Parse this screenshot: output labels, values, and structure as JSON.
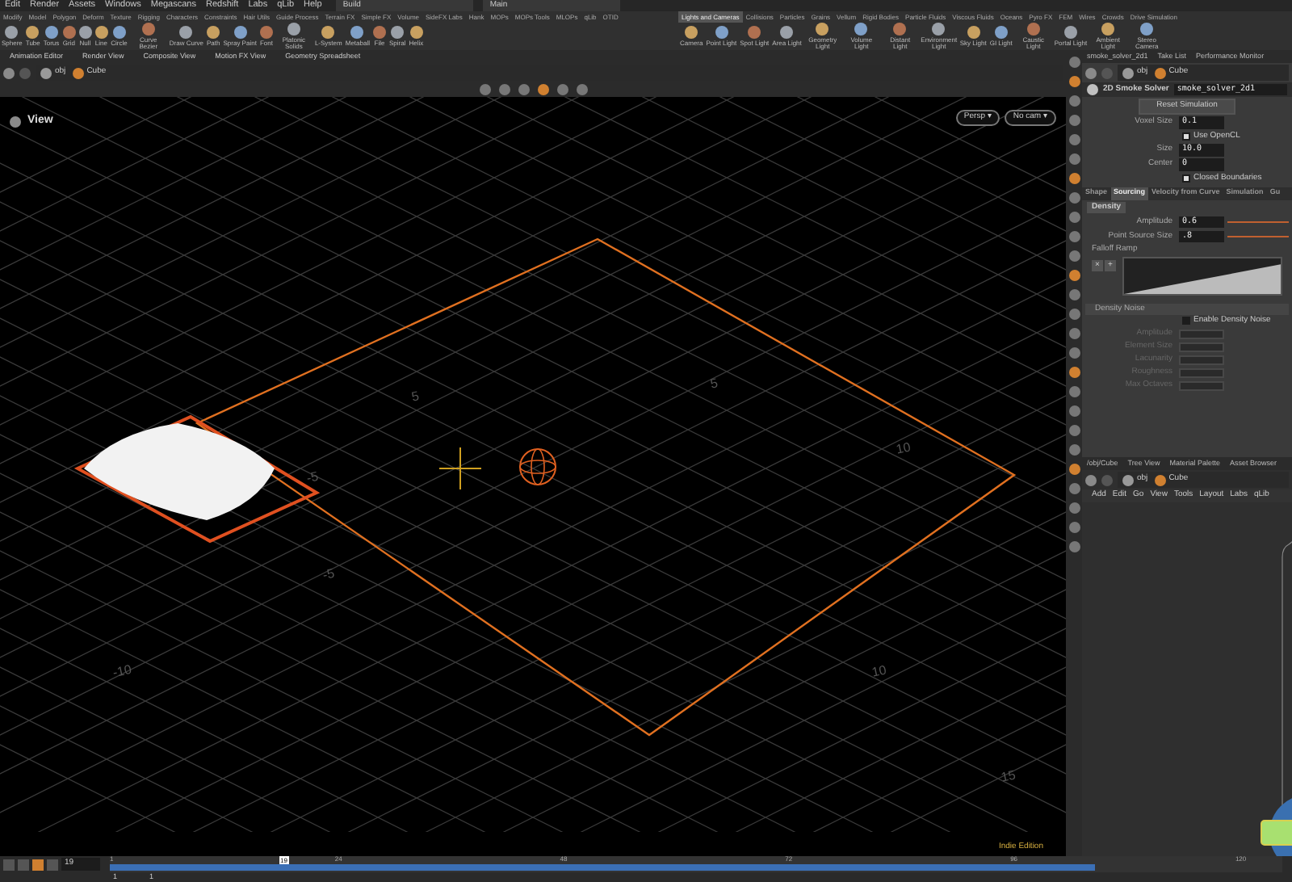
{
  "menu": [
    "Edit",
    "Render",
    "Assets",
    "Windows",
    "Megascans",
    "Redshift",
    "Labs",
    "qLib",
    "Help"
  ],
  "desktops": [
    "Build",
    "Main"
  ],
  "shelf_left": {
    "tabs": [
      {
        "label": "Modify",
        "selected": false
      },
      {
        "label": "Model",
        "selected": false
      },
      {
        "label": "Polygon",
        "selected": false
      },
      {
        "label": "Deform",
        "selected": false
      },
      {
        "label": "Texture",
        "selected": false
      },
      {
        "label": "Rigging",
        "selected": false
      },
      {
        "label": "Characters",
        "selected": false
      },
      {
        "label": "Constraints",
        "selected": false
      },
      {
        "label": "Hair Utils",
        "selected": false
      },
      {
        "label": "Guide Process",
        "selected": false
      },
      {
        "label": "Terrain FX",
        "selected": false
      },
      {
        "label": "Simple FX",
        "selected": false
      },
      {
        "label": "Volume",
        "selected": false
      },
      {
        "label": "SideFX Labs",
        "selected": false
      },
      {
        "label": "Hank",
        "selected": false
      },
      {
        "label": "MOPs",
        "selected": false
      },
      {
        "label": "MOPs Tools",
        "selected": false
      },
      {
        "label": "MLOPs",
        "selected": false
      },
      {
        "label": "qLib",
        "selected": false
      },
      {
        "label": "OTID",
        "selected": false
      }
    ],
    "tools": [
      "Sphere",
      "Tube",
      "Torus",
      "Grid",
      "Null",
      "Line",
      "Circle",
      "Curve Bezier",
      "Draw Curve",
      "Path",
      "Spray Paint",
      "Font",
      "Platonic Solids",
      "L-System",
      "Metaball",
      "File",
      "Spiral",
      "Helix"
    ]
  },
  "shelf_right": {
    "tabs": [
      {
        "label": "Lights and Cameras",
        "selected": true
      },
      {
        "label": "Collisions",
        "selected": false
      },
      {
        "label": "Particles",
        "selected": false
      },
      {
        "label": "Grains",
        "selected": false
      },
      {
        "label": "Vellum",
        "selected": false
      },
      {
        "label": "Rigid Bodies",
        "selected": false
      },
      {
        "label": "Particle Fluids",
        "selected": false
      },
      {
        "label": "Viscous Fluids",
        "selected": false
      },
      {
        "label": "Oceans",
        "selected": false
      },
      {
        "label": "Pyro FX",
        "selected": false
      },
      {
        "label": "FEM",
        "selected": false
      },
      {
        "label": "Wires",
        "selected": false
      },
      {
        "label": "Crowds",
        "selected": false
      },
      {
        "label": "Drive Simulation",
        "selected": false
      }
    ],
    "tools": [
      "Camera",
      "Point Light",
      "Spot Light",
      "Area Light",
      "Geometry Light",
      "Volume Light",
      "Distant Light",
      "Environment Light",
      "Sky Light",
      "GI Light",
      "Caustic Light",
      "Portal Light",
      "Ambient Light",
      "Stereo Camera"
    ]
  },
  "pane_tabs": [
    "Animation Editor",
    "Render View",
    "Composite View",
    "Motion FX View",
    "Geometry Spreadsheet"
  ],
  "path": [
    "obj",
    "Cube"
  ],
  "viewport": {
    "title": "View",
    "camera_menus": [
      "Persp ▾",
      "No cam ▾"
    ],
    "grid_labels": [
      "-10",
      "-5",
      "5",
      "10",
      "15",
      "5",
      "10",
      "-5"
    ],
    "edition": "Indie Edition"
  },
  "param_tabs": [
    "smoke_solver_2d1",
    "Take List",
    "Performance Monitor"
  ],
  "param_path": [
    "obj",
    "Cube"
  ],
  "node": {
    "type": "2D Smoke Solver",
    "name": "smoke_solver_2d1"
  },
  "reset_button": "Reset Simulation",
  "params": [
    {
      "kind": "field",
      "label": "Voxel Size",
      "value": "0.1"
    },
    {
      "kind": "check",
      "label": "Use OpenCL",
      "checked": true
    },
    {
      "kind": "field",
      "label": "Size",
      "value": "10.0"
    },
    {
      "kind": "field",
      "label": "Center",
      "value": "0"
    },
    {
      "kind": "check",
      "label": "Closed Boundaries",
      "checked": true
    }
  ],
  "folder_tabs": [
    {
      "label": "Shape",
      "selected": false
    },
    {
      "label": "Sourcing",
      "selected": true
    },
    {
      "label": "Velocity from Curve",
      "selected": false
    },
    {
      "label": "Simulation",
      "selected": false
    },
    {
      "label": "Gu",
      "selected": false
    }
  ],
  "subtab": "Density",
  "source_params": [
    {
      "label": "Amplitude",
      "value": "0.6"
    },
    {
      "label": "Point Source Size",
      "value": ".8"
    }
  ],
  "ramp": {
    "label": "Falloff Ramp",
    "buttons": [
      "×",
      "+"
    ]
  },
  "noise": {
    "title": "Density Noise",
    "toggle": {
      "label": "Enable Density Noise",
      "checked": false
    },
    "params": [
      "Amplitude",
      "Element Size",
      "Lacunarity",
      "Roughness",
      "Max Octaves"
    ]
  },
  "network_tabs": [
    "/obj/Cube",
    "Tree View",
    "Material Palette",
    "Asset Browser"
  ],
  "network_path": [
    "obj",
    "Cube"
  ],
  "network_menu": [
    "Add",
    "Edit",
    "Go",
    "View",
    "Tools",
    "Layout",
    "Labs",
    "qLib"
  ],
  "timeline": {
    "frame": "19",
    "marker": "19",
    "ticks": [
      "1",
      "24",
      "48",
      "72",
      "96",
      "120"
    ],
    "level": 0.84,
    "range": [
      "1",
      "1"
    ]
  }
}
